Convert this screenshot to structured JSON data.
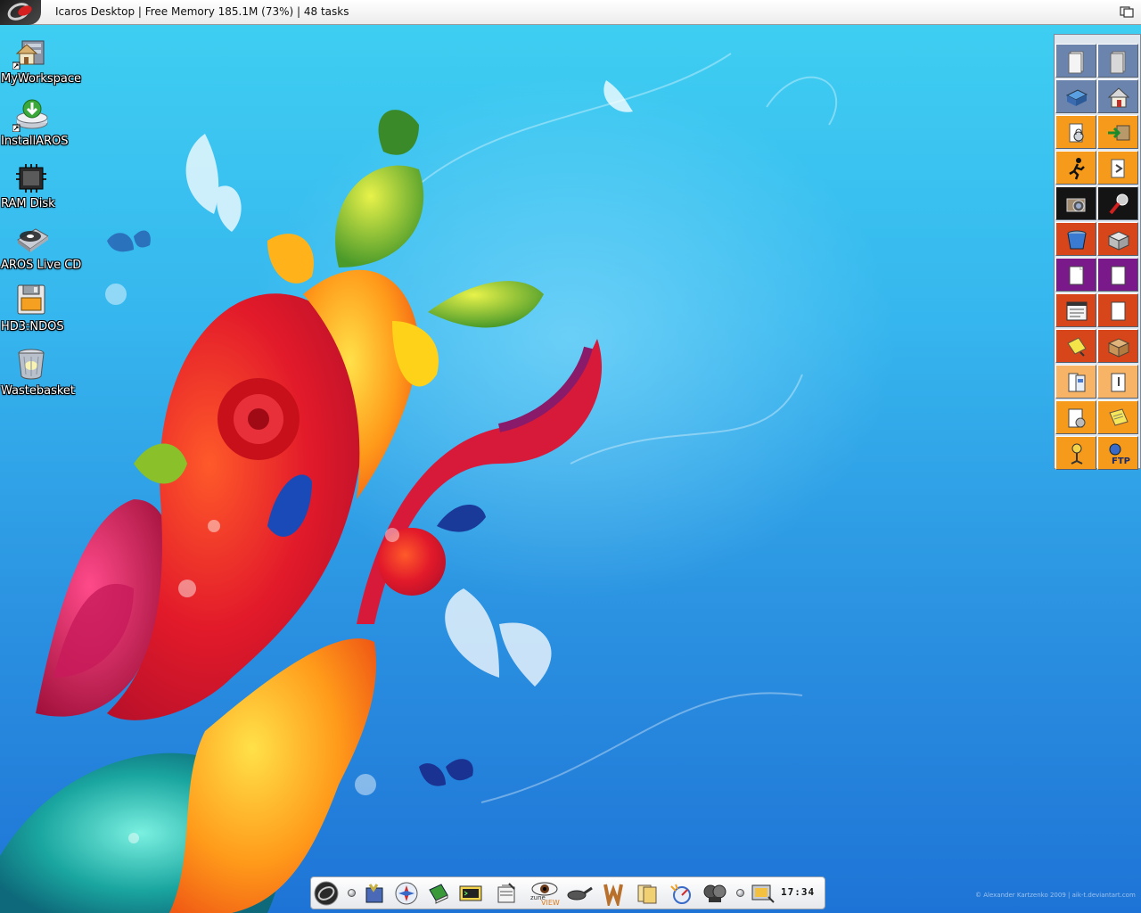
{
  "window": {
    "title": "Icaros Desktop | Free Memory 185.1M (73%) | 48 tasks"
  },
  "desktop_icons": [
    {
      "label": "MyWorkspace",
      "icon": "workspace-icon"
    },
    {
      "label": "InstallAROS",
      "icon": "install-icon"
    },
    {
      "label": "RAM Disk",
      "icon": "ramdisk-icon"
    },
    {
      "label": "AROS Live CD",
      "icon": "cdrom-icon"
    },
    {
      "label": "HD3:NDOS",
      "icon": "floppy-icon"
    },
    {
      "label": "Wastebasket",
      "icon": "trash-icon"
    }
  ],
  "dock": {
    "rows": [
      {
        "color": "#6b84ad",
        "icons": [
          "document-icon",
          "document-icon"
        ]
      },
      {
        "color": "#6b84ad",
        "icons": [
          "drive-icon",
          "home-icon"
        ]
      },
      {
        "color": "#f59a1a",
        "icons": [
          "lock-icon",
          "enter-icon"
        ]
      },
      {
        "color": "#f59a1a",
        "icons": [
          "run-icon",
          "document-arrow-icon"
        ]
      },
      {
        "color": "#141414",
        "icons": [
          "camera-icon",
          "microphone-icon"
        ]
      },
      {
        "color": "#d6461a",
        "icons": [
          "bucket-icon",
          "box-icon"
        ]
      },
      {
        "color": "#7a1a8a",
        "icons": [
          "note-icon",
          "document-icon"
        ]
      },
      {
        "color": "#d6461a",
        "icons": [
          "terminal-icon",
          "document-icon"
        ]
      },
      {
        "color": "#d6461a",
        "icons": [
          "sticky-note-icon",
          "package-icon"
        ]
      },
      {
        "color": "#f7b366",
        "icons": [
          "install-disk-icon",
          "document-pen-icon"
        ]
      },
      {
        "color": "#f59a1a",
        "icons": [
          "settings-doc-icon",
          "notepad-icon"
        ]
      },
      {
        "color": "#f59a1a",
        "icons": [
          "network-icon",
          "ftp-icon"
        ]
      }
    ],
    "ftp_label": "FTP"
  },
  "launcher": {
    "items": [
      "aros-logo-icon",
      "separator",
      "file-manager-icon",
      "browser-icon",
      "book-icon",
      "terminal-icon",
      "editor-icon",
      "zune-view-icon",
      "pan-icon",
      "wanderer-icon",
      "notes-icon",
      "radar-icon",
      "game-icon",
      "separator",
      "monitor-icon"
    ],
    "zune_text": "zune",
    "view_text": "VIEW",
    "clock": "17:34"
  },
  "credit": "© Alexander Kartzenko 2009 | aik-t.deviantart.com"
}
